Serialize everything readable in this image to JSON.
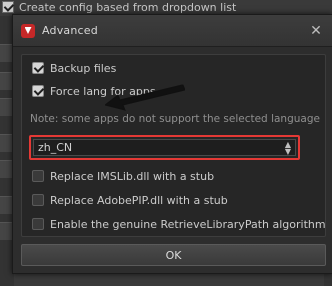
{
  "background": {
    "top_checkbox_label": "Create config based from dropdown list",
    "top_checkbox_checked": true
  },
  "dialog": {
    "title": "Advanced",
    "close_glyph": "✕",
    "options": {
      "backup_files": {
        "label": "Backup files",
        "checked": true
      },
      "force_lang": {
        "label": "Force lang for apps",
        "checked": true
      },
      "note": "Note: some apps do not support the selected language",
      "language_select": {
        "value": "zh_CN",
        "arrows": "▲▼"
      },
      "replace_imslib": {
        "label": "Replace IMSLib.dll with a stub",
        "checked": false
      },
      "replace_adobepip": {
        "label": "Replace AdobePIP.dll with a stub",
        "checked": false
      },
      "enable_retrieve": {
        "label": "Enable the genuine RetrieveLibraryPath algorithm",
        "checked": false
      }
    },
    "ok_label": "OK"
  },
  "colors": {
    "highlight": "#e53935",
    "app_icon": "#c62828",
    "annotation_arrow": "#111111"
  },
  "icons": {
    "app": "adobe-logo-icon",
    "close": "close-icon",
    "annotation": "arrow-pointer-icon"
  }
}
